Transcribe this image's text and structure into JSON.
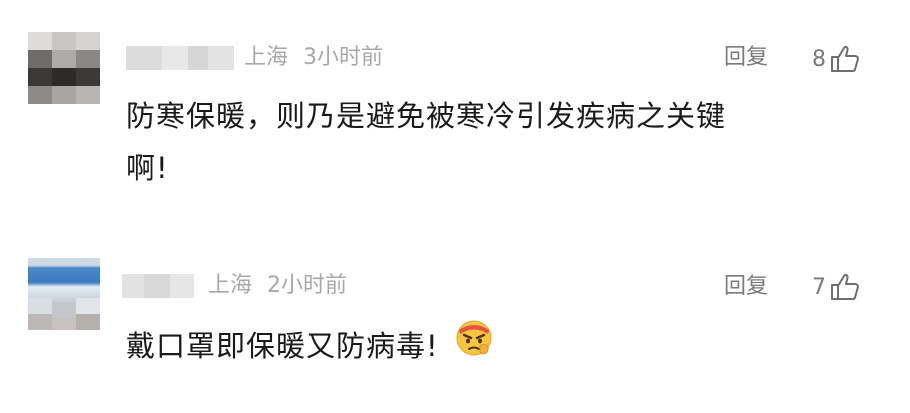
{
  "comments": [
    {
      "location": "上海",
      "time": "3小时前",
      "reply_label": "回复",
      "like_count": "8",
      "text_line1": "防寒保暖，则乃是避免被寒冷引发疾病之关键",
      "text_line2": "啊!"
    },
    {
      "location": "上海",
      "time": "2小时前",
      "reply_label": "回复",
      "like_count": "7",
      "text_line1": "戴口罩即保暖又防病毒!"
    }
  ],
  "icons": {
    "like": "thumbs-up-icon",
    "emoji": "angry-face-emoji"
  },
  "colors": {
    "meta_gray": "#a8a8a8",
    "action_gray": "#7a7a7a",
    "text": "#1a1a1a"
  }
}
